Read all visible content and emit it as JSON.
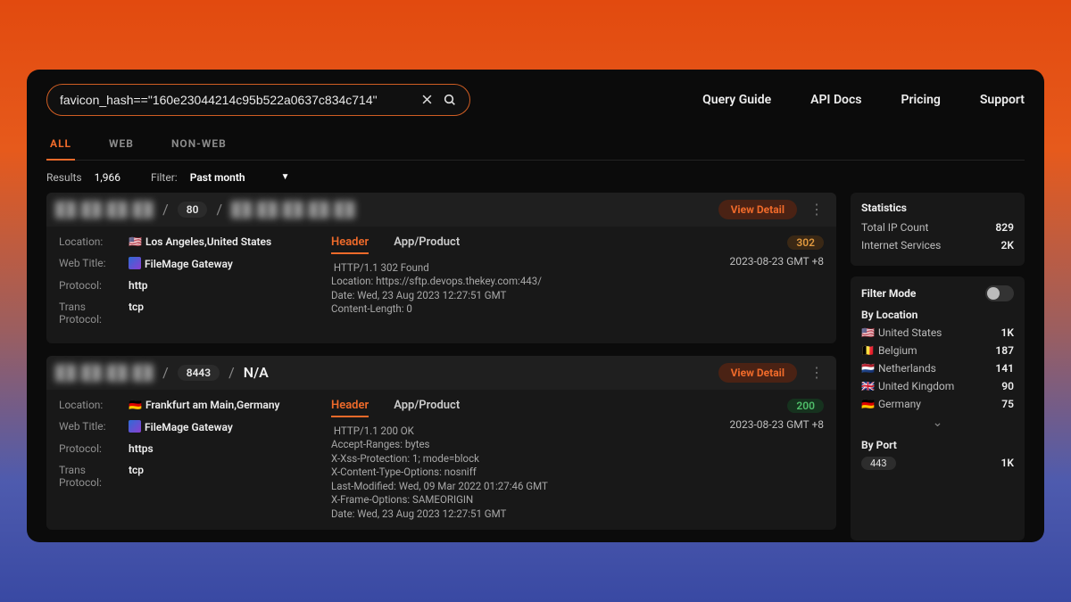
{
  "search": {
    "value": "favicon_hash==\"160e23044214c95b522a0637c834c714\""
  },
  "nav": {
    "query_guide": "Query Guide",
    "api_docs": "API Docs",
    "pricing": "Pricing",
    "support": "Support"
  },
  "tabs": {
    "all": "ALL",
    "web": "WEB",
    "nonweb": "NON-WEB"
  },
  "results_bar": {
    "label": "Results",
    "count": "1,966",
    "filter_label": "Filter:",
    "filter_value": "Past month"
  },
  "labels": {
    "location": "Location:",
    "web_title": "Web Title:",
    "protocol": "Protocol:",
    "trans_protocol": "Trans Protocol:",
    "view_detail": "View Detail"
  },
  "resp_tabs": {
    "header": "Header",
    "app": "App/Product"
  },
  "results": [
    {
      "ip_obscured": "██.██.██.██",
      "port": "80",
      "host_obscured": "██.██.██.██.██",
      "location": "Los Angeles,United States",
      "flag": "🇺🇸",
      "web_title": "FileMage Gateway",
      "protocol": "http",
      "trans_protocol": "tcp",
      "status": "302",
      "status_class": "st-302",
      "timestamp": "2023-08-23 GMT +8",
      "response": " HTTP/1.1 302 Found\nLocation: https://sftp.devops.thekey.com:443/\nDate: Wed, 23 Aug 2023 12:27:51 GMT\nContent-Length: 0"
    },
    {
      "ip_obscured": "██.██.██.██",
      "port": "8443",
      "host_obscured": "N/A",
      "location": "Frankfurt am Main,Germany",
      "flag": "🇩🇪",
      "web_title": "FileMage Gateway",
      "protocol": "https",
      "trans_protocol": "tcp",
      "status": "200",
      "status_class": "st-200",
      "timestamp": "2023-08-23 GMT +8",
      "response": " HTTP/1.1 200 OK\nAccept-Ranges: bytes\nX-Xss-Protection: 1; mode=block\nX-Content-Type-Options: nosniff\nLast-Modified: Wed, 09 Mar 2022 01:27:46 GMT\nX-Frame-Options: SAMEORIGIN\nDate: Wed, 23 Aug 2023 12:27:51 GMT"
    }
  ],
  "stats": {
    "title": "Statistics",
    "rows": [
      {
        "k": "Total IP Count",
        "v": "829"
      },
      {
        "k": "Internet Services",
        "v": "2K"
      }
    ]
  },
  "filters": {
    "mode_label": "Filter Mode",
    "by_location_label": "By Location",
    "locations": [
      {
        "flag": "🇺🇸",
        "name": "United States",
        "count": "1K"
      },
      {
        "flag": "🇧🇪",
        "name": "Belgium",
        "count": "187"
      },
      {
        "flag": "🇳🇱",
        "name": "Netherlands",
        "count": "141"
      },
      {
        "flag": "🇬🇧",
        "name": "United Kingdom",
        "count": "90"
      },
      {
        "flag": "🇩🇪",
        "name": "Germany",
        "count": "75"
      }
    ],
    "by_port_label": "By Port",
    "ports": [
      {
        "port": "443",
        "count": "1K"
      }
    ]
  }
}
